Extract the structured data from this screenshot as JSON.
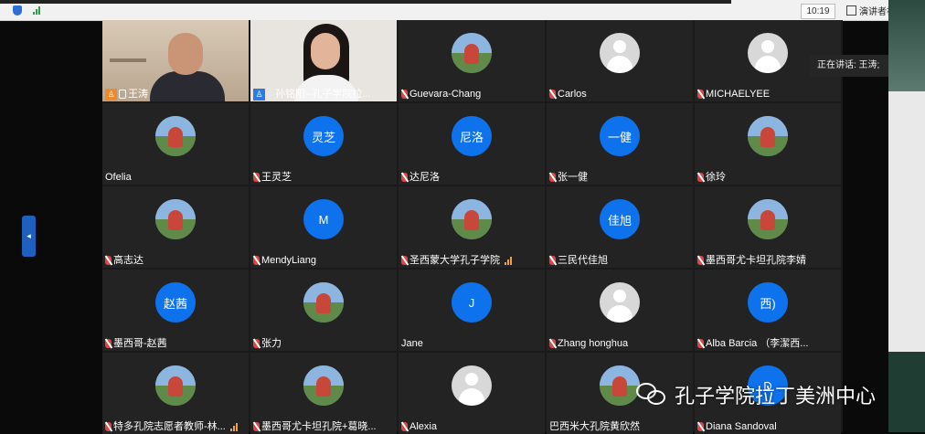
{
  "topbar": {
    "clock": "10:19",
    "speaker_view_label": "演讲者视"
  },
  "speaking_indicator": "正在讲话: 王涛;",
  "watermark": "孔子学院拉丁美洲中心",
  "tiles": [
    {
      "row": 0,
      "col": 0,
      "type": "video1",
      "name": "王涛",
      "badge": "host",
      "phone": true,
      "active": true
    },
    {
      "row": 0,
      "col": 1,
      "type": "video2",
      "name": "孙铭阳--孔子学院拉...",
      "badge": "cohost",
      "mic": "on"
    },
    {
      "row": 0,
      "col": 2,
      "type": "photo",
      "name": "Guevara-Chang",
      "mic": "muted"
    },
    {
      "row": 0,
      "col": 3,
      "type": "gray",
      "name": "Carlos",
      "mic": "muted"
    },
    {
      "row": 0,
      "col": 4,
      "type": "gray",
      "name": "MICHAELYEE",
      "mic": "muted"
    },
    {
      "row": 1,
      "col": 0,
      "type": "photo",
      "name": "Ofelia"
    },
    {
      "row": 1,
      "col": 1,
      "type": "blue",
      "initials": "灵芝",
      "name": "王灵芝",
      "mic": "muted"
    },
    {
      "row": 1,
      "col": 2,
      "type": "blue",
      "initials": "尼洛",
      "name": "达尼洛",
      "mic": "muted"
    },
    {
      "row": 1,
      "col": 3,
      "type": "blue",
      "initials": "一健",
      "name": "张一健",
      "mic": "muted"
    },
    {
      "row": 1,
      "col": 4,
      "type": "photo",
      "name": "徐玲",
      "mic": "muted"
    },
    {
      "row": 2,
      "col": 0,
      "type": "photo",
      "name": "高志达",
      "mic": "muted"
    },
    {
      "row": 2,
      "col": 1,
      "type": "blue",
      "initials": "M",
      "name": "MendyLiang",
      "mic": "muted"
    },
    {
      "row": 2,
      "col": 2,
      "type": "photo",
      "name": "圣西蒙大学孔子学院",
      "mic": "muted",
      "bars": true
    },
    {
      "row": 2,
      "col": 3,
      "type": "blue",
      "initials": "佳旭",
      "name": "三民代佳旭",
      "mic": "muted"
    },
    {
      "row": 2,
      "col": 4,
      "type": "photo",
      "name": "墨西哥尤卡坦孔院李婧",
      "mic": "muted"
    },
    {
      "row": 3,
      "col": 0,
      "type": "blue",
      "initials": "赵茜",
      "name": "墨西哥-赵茜",
      "mic": "muted"
    },
    {
      "row": 3,
      "col": 1,
      "type": "photo",
      "name": "张力",
      "mic": "muted"
    },
    {
      "row": 3,
      "col": 2,
      "type": "blue",
      "initials": "J",
      "name": "Jane"
    },
    {
      "row": 3,
      "col": 3,
      "type": "gray",
      "name": "Zhang honghua",
      "mic": "muted"
    },
    {
      "row": 3,
      "col": 4,
      "type": "blue",
      "initials": "西)",
      "name": "Alba Barcia （李潔西...",
      "mic": "muted"
    },
    {
      "row": 4,
      "col": 0,
      "type": "photo",
      "name": "特多孔院志愿者教师-林...",
      "mic": "muted",
      "bars": true
    },
    {
      "row": 4,
      "col": 1,
      "type": "photo",
      "name": "墨西哥尤卡坦孔院+葛晓...",
      "mic": "muted"
    },
    {
      "row": 4,
      "col": 2,
      "type": "gray",
      "name": "Alexia",
      "mic": "muted"
    },
    {
      "row": 4,
      "col": 3,
      "type": "photo",
      "name": "巴西米大孔院黄欣然"
    },
    {
      "row": 4,
      "col": 4,
      "type": "blue",
      "initials": "D",
      "name": "Diana Sandoval",
      "mic": "muted"
    }
  ]
}
